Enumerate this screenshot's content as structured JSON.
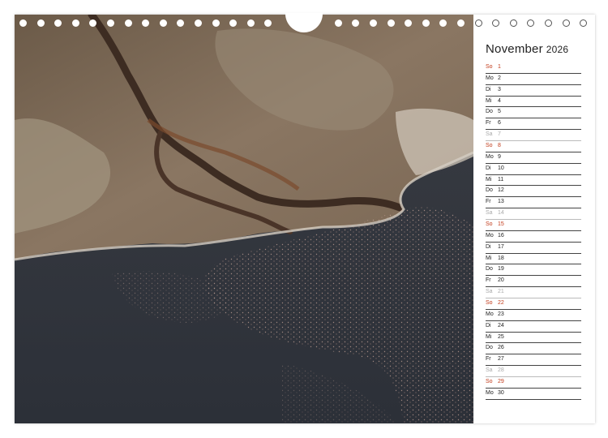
{
  "calendar": {
    "month": "November",
    "year": "2026",
    "days": [
      {
        "wd": "So",
        "d": "1",
        "type": "sunday"
      },
      {
        "wd": "Mo",
        "d": "2",
        "type": "weekday"
      },
      {
        "wd": "Di",
        "d": "3",
        "type": "weekday"
      },
      {
        "wd": "Mi",
        "d": "4",
        "type": "weekday"
      },
      {
        "wd": "Do",
        "d": "5",
        "type": "weekday"
      },
      {
        "wd": "Fr",
        "d": "6",
        "type": "weekday"
      },
      {
        "wd": "Sa",
        "d": "7",
        "type": "saturday"
      },
      {
        "wd": "So",
        "d": "8",
        "type": "sunday"
      },
      {
        "wd": "Mo",
        "d": "9",
        "type": "weekday"
      },
      {
        "wd": "Di",
        "d": "10",
        "type": "weekday"
      },
      {
        "wd": "Mi",
        "d": "11",
        "type": "weekday"
      },
      {
        "wd": "Do",
        "d": "12",
        "type": "weekday"
      },
      {
        "wd": "Fr",
        "d": "13",
        "type": "weekday"
      },
      {
        "wd": "Sa",
        "d": "14",
        "type": "saturday"
      },
      {
        "wd": "So",
        "d": "15",
        "type": "sunday"
      },
      {
        "wd": "Mo",
        "d": "16",
        "type": "weekday"
      },
      {
        "wd": "Di",
        "d": "17",
        "type": "weekday"
      },
      {
        "wd": "Mi",
        "d": "18",
        "type": "weekday"
      },
      {
        "wd": "Do",
        "d": "19",
        "type": "weekday"
      },
      {
        "wd": "Fr",
        "d": "20",
        "type": "weekday"
      },
      {
        "wd": "Sa",
        "d": "21",
        "type": "saturday"
      },
      {
        "wd": "So",
        "d": "22",
        "type": "sunday"
      },
      {
        "wd": "Mo",
        "d": "23",
        "type": "weekday"
      },
      {
        "wd": "Di",
        "d": "24",
        "type": "weekday"
      },
      {
        "wd": "Mi",
        "d": "25",
        "type": "weekday"
      },
      {
        "wd": "Do",
        "d": "26",
        "type": "weekday"
      },
      {
        "wd": "Fr",
        "d": "27",
        "type": "weekday"
      },
      {
        "wd": "Sa",
        "d": "28",
        "type": "saturday"
      },
      {
        "wd": "So",
        "d": "29",
        "type": "sunday"
      },
      {
        "wd": "Mo",
        "d": "30",
        "type": "weekday"
      }
    ]
  },
  "colors": {
    "sunday": "#c23a1a",
    "saturday": "#aaaaaa",
    "weekday": "#222222"
  }
}
